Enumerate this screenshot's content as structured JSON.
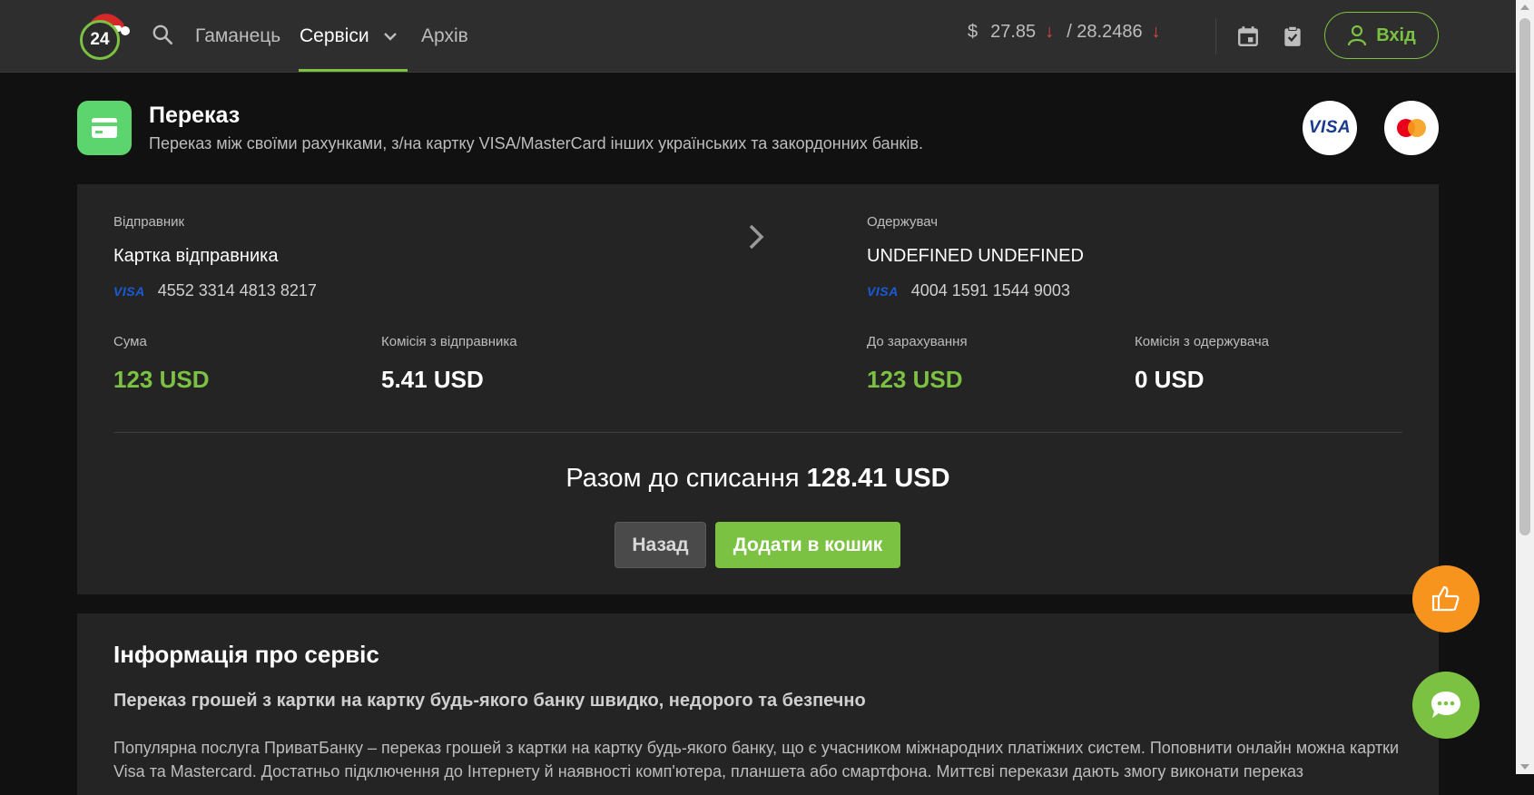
{
  "header": {
    "logo_text": "24",
    "nav": {
      "wallet": "Гаманець",
      "services": "Сервіси",
      "archive": "Архів"
    },
    "rates": {
      "currency_symbol": "$",
      "buy": "27.85",
      "sell": "/ 28.2486",
      "trend_arrow": "↓"
    },
    "login_label": "Вхід",
    "colors": {
      "accent": "#7cc242",
      "rate_down": "#e0463e"
    }
  },
  "service": {
    "title": "Переказ",
    "description": "Переказ між своїми рахунками, з/на картку VISA/MasterCard інших українських та закордонних банків.",
    "brands": [
      "visa-logo",
      "mastercard-logo"
    ],
    "brand_visa_text": "VISA"
  },
  "transfer": {
    "sender": {
      "label": "Відправник",
      "name": "Картка відправника",
      "card_brand": "VISA",
      "card_number": "4552 3314 4813 8217"
    },
    "recipient": {
      "label": "Одержувач",
      "name": "UNDEFINED UNDEFINED",
      "card_brand": "VISA",
      "card_number": "4004 1591 1544 9003"
    },
    "amount": {
      "label": "Сума",
      "value": "123 USD"
    },
    "sender_fee": {
      "label": "Комісія з відправника",
      "value": "5.41 USD"
    },
    "credited": {
      "label": "До зарахування",
      "value": "123 USD"
    },
    "recipient_fee": {
      "label": "Комісія з одержувача",
      "value": "0 USD"
    },
    "total_label": "Разом до списання",
    "total_value": "128.41 USD",
    "back_button": "Назад",
    "add_to_cart_button": "Додати в кошик"
  },
  "info": {
    "heading": "Інформація про сервіс",
    "subheading": "Переказ грошей з картки на картку будь-якого банку швидко, недорого та безпечно",
    "body": "Популярна послуга ПриватБанку – переказ грошей з картки на картку будь-якого банку, що є учасником міжнародних платіжних систем. Поповнити онлайн можна картки Visa та Mastercard. Достатньо підключення до Інтернету й наявності комп'ютера, планшета або смартфона. Миттєві перекази дають змогу виконати переказ"
  },
  "floating": {
    "feedback_icon": "thumbs-up-icon",
    "chat_icon": "chat-bubble-icon",
    "feedback_color": "#f7941d",
    "chat_color": "#7cc242"
  }
}
